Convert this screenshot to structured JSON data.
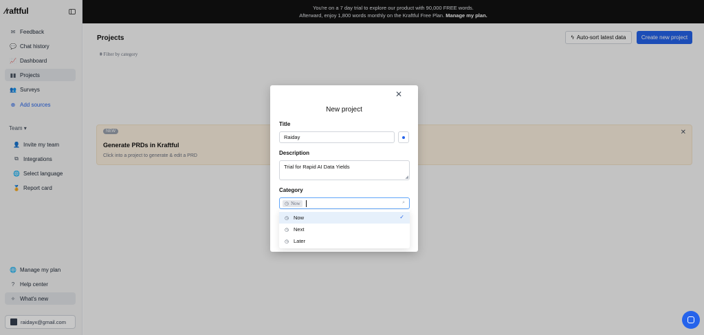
{
  "sidebar": {
    "logo": "⁄raftful",
    "items": [
      {
        "label": "Feedback",
        "icon": "feedback-icon",
        "glyph": "✉"
      },
      {
        "label": "Chat history",
        "icon": "chat-icon",
        "glyph": "💬"
      },
      {
        "label": "Dashboard",
        "icon": "chart-icon",
        "glyph": "📈"
      },
      {
        "label": "Projects",
        "icon": "projects-icon",
        "glyph": "▮▮"
      },
      {
        "label": "Surveys",
        "icon": "survey-icon",
        "glyph": "👥"
      },
      {
        "label": "Add sources",
        "icon": "plus-circle-icon",
        "glyph": "⊕"
      }
    ],
    "team_label": "Team ▾",
    "team_items": [
      {
        "label": "Invite my team",
        "icon": "invite-icon",
        "glyph": "👤"
      },
      {
        "label": "Integrations",
        "icon": "integrations-icon",
        "glyph": "⧉"
      },
      {
        "label": "Select language",
        "icon": "language-icon",
        "glyph": "🌐"
      },
      {
        "label": "Report card",
        "icon": "report-icon",
        "glyph": "🏅"
      }
    ],
    "bottom_items": [
      {
        "label": "Manage my plan",
        "icon": "plan-icon",
        "glyph": "🌐"
      },
      {
        "label": "Help center",
        "icon": "help-icon",
        "glyph": "?"
      },
      {
        "label": "What's new",
        "icon": "sparkle-icon",
        "glyph": "✧"
      }
    ],
    "user_email": "raidayx@gmail.com"
  },
  "banner": {
    "line1": "You're on a 7 day trial to explore our product with 90,000 FREE words.",
    "line2": "Afterward, enjoy 1,800 words monthly on the Kraftful Free Plan.",
    "link": "Manage my plan."
  },
  "main": {
    "title": "Projects",
    "filter": "Filter by category",
    "auto_sort": "Auto-sort latest data",
    "create": "Create new project",
    "prd_badge": "NEW",
    "prd_title": "Generate PRDs in Kraftful",
    "prd_sub": "Click into a project to generate & edit a PRD"
  },
  "modal": {
    "title": "New project",
    "title_label": "Title",
    "title_value": "Raiday",
    "description_label": "Description",
    "description_value": "Trial for Rapid AI Data Yields",
    "category_label": "Category",
    "selected_chip": "Now",
    "options": [
      "Now",
      "Next",
      "Later"
    ]
  },
  "colors": {
    "accent": "#2563eb",
    "banner_bg": "#111111",
    "prd_bg": "#fdf1e1"
  }
}
